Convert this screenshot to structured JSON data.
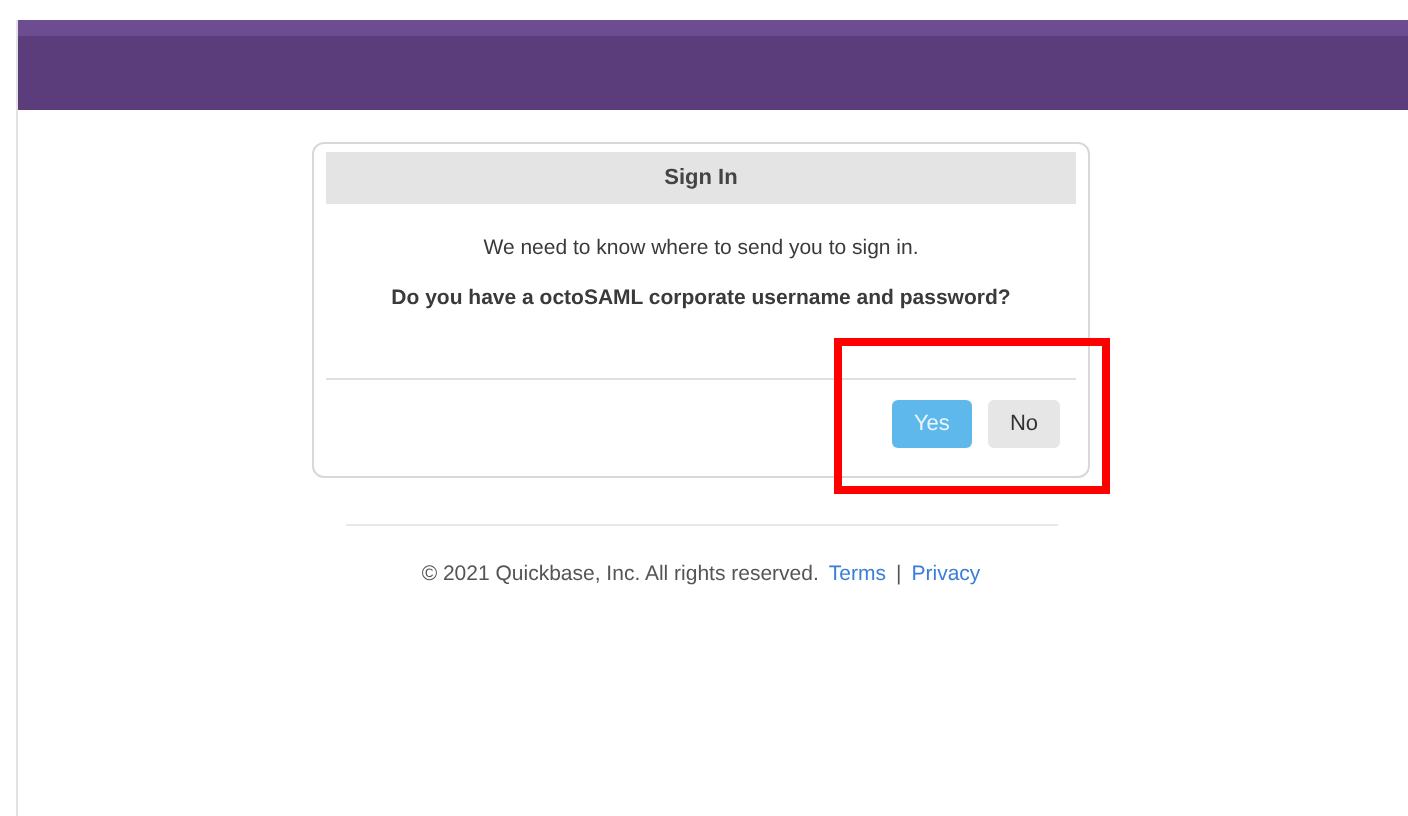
{
  "dialog": {
    "title": "Sign In",
    "lines": [
      "We need to know where to send you to sign in.",
      "Do you have a octoSAML corporate username and password?"
    ],
    "buttons": [
      {
        "label": "Yes",
        "kind": "primary"
      },
      {
        "label": "No",
        "kind": "secondary"
      }
    ],
    "highlight_frame": true
  },
  "footer": {
    "copyright": "© 2021 Quickbase, Inc. All rights reserved.",
    "links": [
      "Terms",
      "Privacy"
    ],
    "separator": "|"
  }
}
